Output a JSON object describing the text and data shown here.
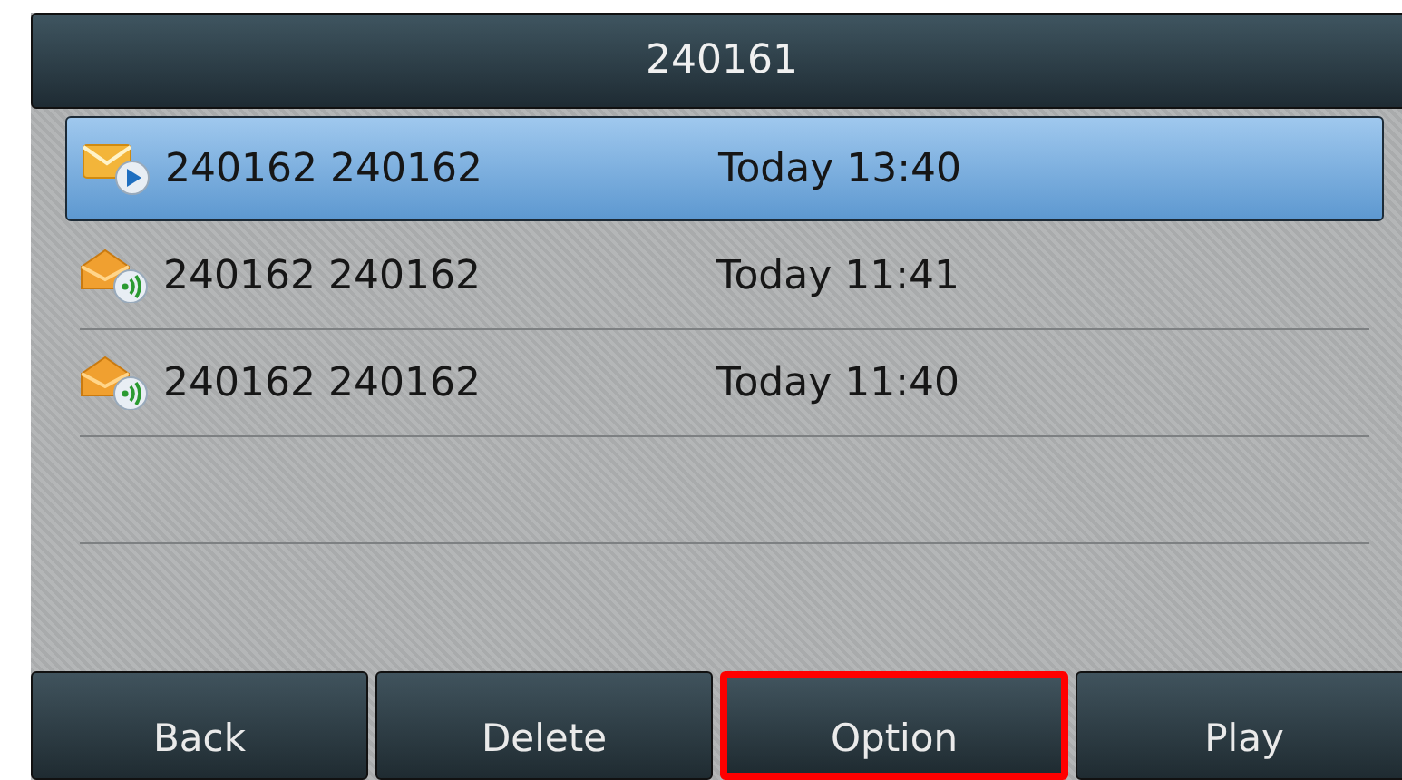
{
  "title_bar": {
    "title": "240161"
  },
  "messages": [
    {
      "kind": "playing",
      "name": "240162 240162",
      "time": "Today 13:40",
      "selected": true
    },
    {
      "kind": "unread",
      "name": "240162 240162",
      "time": "Today 11:41",
      "selected": false
    },
    {
      "kind": "unread",
      "name": "240162 240162",
      "time": "Today 11:40",
      "selected": false
    }
  ],
  "softkeys": [
    {
      "label": "Back",
      "highlighted": false
    },
    {
      "label": "Delete",
      "highlighted": false
    },
    {
      "label": "Option",
      "highlighted": true
    },
    {
      "label": "Play",
      "highlighted": false
    }
  ]
}
